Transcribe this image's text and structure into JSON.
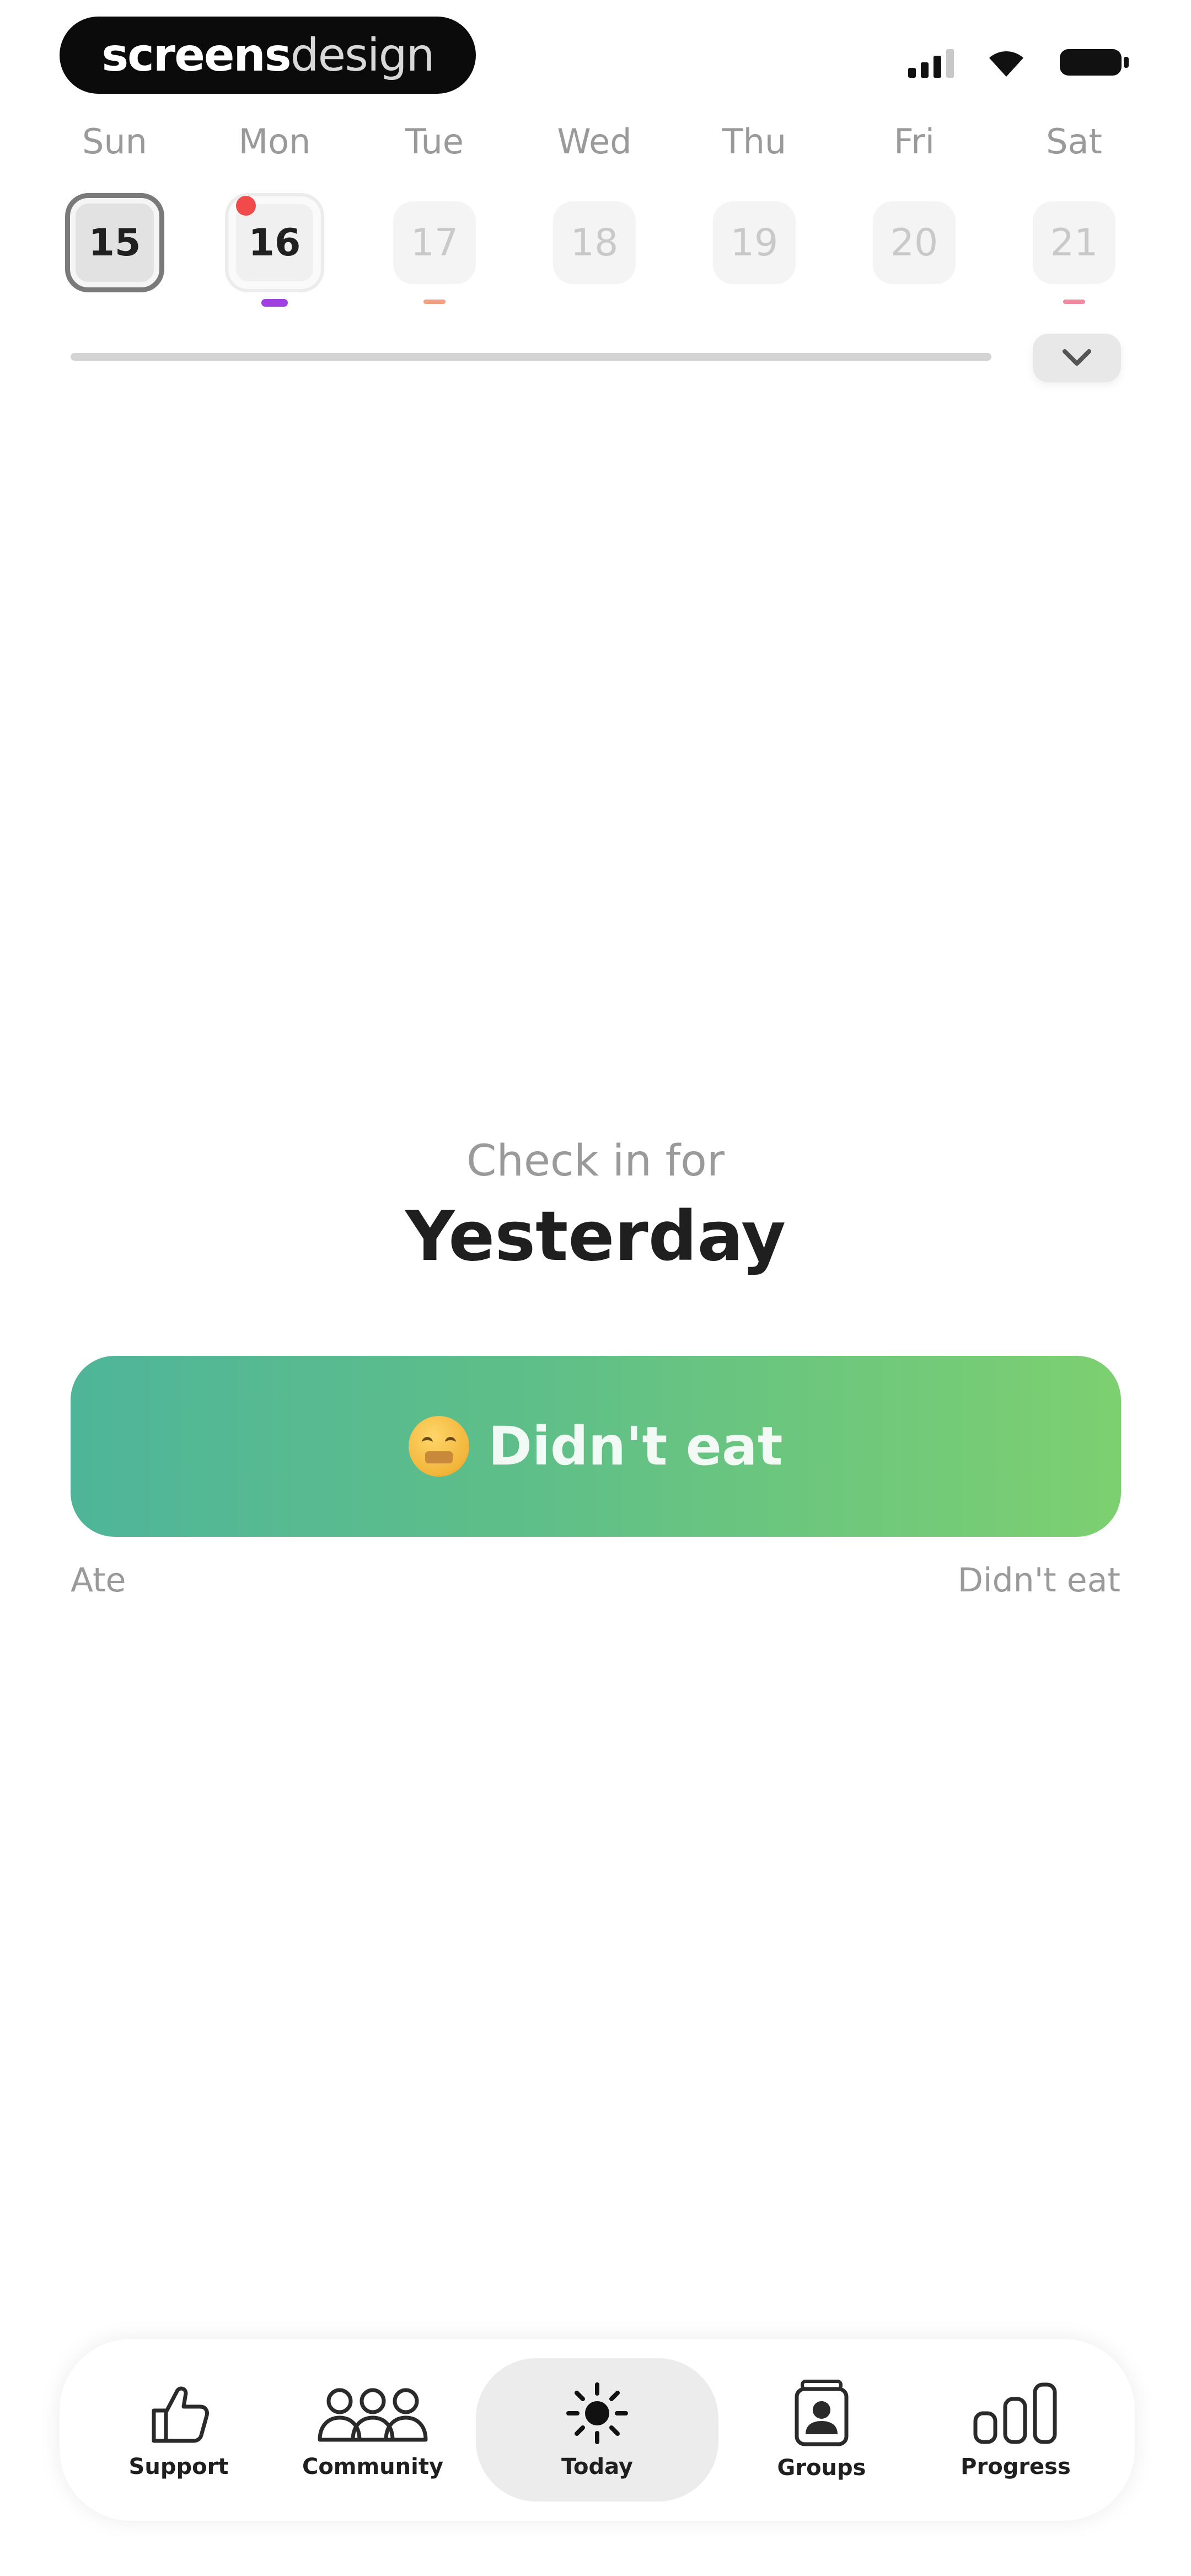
{
  "app": {
    "watermark_bold": "screens",
    "watermark_light": "design"
  },
  "status_bar": {
    "signal_icon": "signal-icon",
    "wifi_icon": "wifi-icon",
    "battery_icon": "battery-icon"
  },
  "week": {
    "days": [
      "Sun",
      "Mon",
      "Tue",
      "Wed",
      "Thu",
      "Fri",
      "Sat"
    ],
    "dates": [
      "15",
      "16",
      "17",
      "18",
      "19",
      "20",
      "21"
    ],
    "expand_icon": "chevron-down-icon"
  },
  "checkin": {
    "caption": "Check in for",
    "day": "Yesterday",
    "slider_label": "Didn't eat",
    "scale_left": "Ate",
    "scale_right": "Didn't eat",
    "gradient_start": "#4fb599",
    "gradient_end": "#7dd070"
  },
  "tabs": [
    {
      "label": "Support",
      "icon": "thumbs-up-icon"
    },
    {
      "label": "Community",
      "icon": "people-icon"
    },
    {
      "label": "Today",
      "icon": "sun-icon"
    },
    {
      "label": "Groups",
      "icon": "group-icon"
    },
    {
      "label": "Progress",
      "icon": "bar-chart-icon"
    }
  ],
  "colors": {
    "marker_purple": "#a040e0",
    "marker_orange": "#f2a084",
    "marker_pink": "#f08aa0",
    "notification_red": "#f04a4a"
  }
}
